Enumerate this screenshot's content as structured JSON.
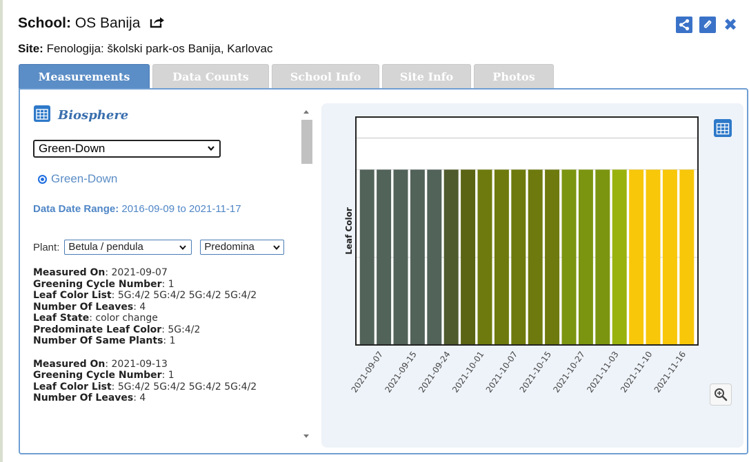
{
  "header": {
    "school_label": "School:",
    "school_name": "OS Banija",
    "site_label": "Site:",
    "site_name": "Fenologija: školski park-os Banija, Karlovac"
  },
  "tabs": [
    {
      "label": "Measurements",
      "active": true
    },
    {
      "label": "Data Counts",
      "active": false
    },
    {
      "label": "School Info",
      "active": false
    },
    {
      "label": "Site Info",
      "active": false
    },
    {
      "label": "Photos",
      "active": false
    }
  ],
  "left": {
    "section_title": "Biosphere",
    "protocol_select": "Green-Down",
    "radio_label": "Green-Down",
    "date_range_label": "Data Date Range:",
    "date_range_value": "2016-09-09 to 2021-11-17",
    "plant_label": "Plant:",
    "plant_select": "Betula / pendula",
    "leaf_select": "Predomina",
    "records": [
      {
        "measured_on_label": "Measured On",
        "measured_on": ": 2021-09-07",
        "cycle_label": "Greening Cycle Number",
        "cycle": ": 1",
        "leaf_color_list_label": "Leaf Color List",
        "leaf_color_list": ": 5G:4/2 5G:4/2 5G:4/2 5G:4/2",
        "leaves_label": "Number Of Leaves",
        "leaves": ": 4",
        "leaf_state_label": "Leaf State",
        "leaf_state": ": color change",
        "predominate_label": "Predominate Leaf Color",
        "predominate": ": 5G:4/2",
        "same_plants_label": "Number Of Same Plants",
        "same_plants": ": 1"
      },
      {
        "measured_on_label": "Measured On",
        "measured_on": ": 2021-09-13",
        "cycle_label": "Greening Cycle Number",
        "cycle": ": 1",
        "leaf_color_list_label": "Leaf Color List",
        "leaf_color_list": ": 5G:4/2 5G:4/2 5G:4/2 5G:4/2",
        "leaves_label": "Number Of Leaves",
        "leaves": ": 4"
      }
    ]
  },
  "icons": {
    "share": "share-icon",
    "link": "link-icon",
    "close": "close-icon",
    "external": "external-link-icon",
    "table": "table-icon",
    "zoom": "zoom-in-icon"
  },
  "chart_data": {
    "type": "bar",
    "ylabel": "Leaf Color",
    "xlabel": "",
    "grid": true,
    "ylim": [
      0,
      1.3
    ],
    "tick_labels": [
      "2021-09-07",
      "2021-09-15",
      "2021-09-24",
      "2021-10-01",
      "2021-10-07",
      "2021-10-15",
      "2021-10-27",
      "2021-11-03",
      "2021-11-10",
      "2021-11-16"
    ],
    "categories": [
      "2021-09-07",
      "",
      "2021-09-15",
      "",
      "2021-09-24",
      "",
      "2021-10-01",
      "",
      "2021-10-07",
      "",
      "2021-10-15",
      "",
      "2021-10-27",
      "",
      "2021-11-03",
      "",
      "2021-11-10",
      "",
      "2021-11-16",
      ""
    ],
    "values": [
      1,
      1,
      1,
      1,
      1,
      1,
      1,
      1,
      1,
      1,
      1,
      1,
      1,
      1,
      1,
      1,
      1,
      1,
      1,
      1
    ],
    "colors": [
      "#52635a",
      "#52635a",
      "#52635a",
      "#52635a",
      "#52635a",
      "#4f5b2d",
      "#5a6412",
      "#6e7a0d",
      "#6e7a0d",
      "#6e7a0d",
      "#6e7a0d",
      "#6e7a0d",
      "#7c9510",
      "#7c9510",
      "#7c9510",
      "#9ab20e",
      "#f8c70a",
      "#f8c70a",
      "#f8c70a",
      "#f8c70a"
    ]
  }
}
